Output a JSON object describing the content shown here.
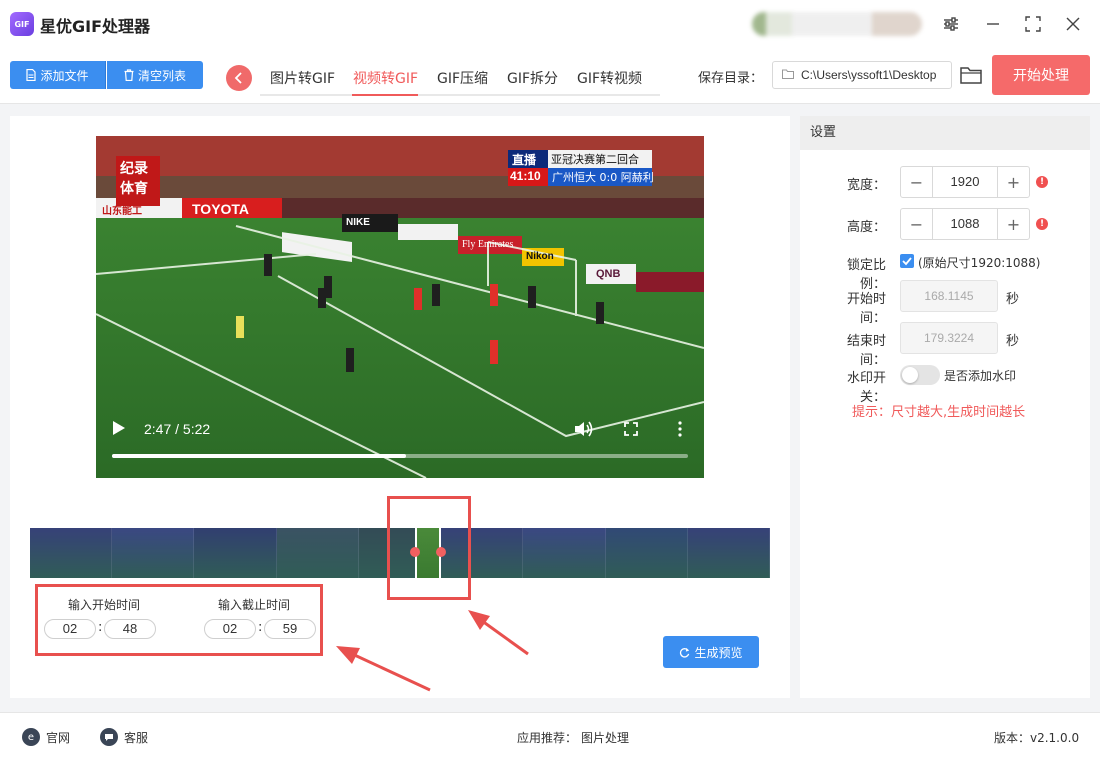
{
  "app": {
    "title": "星优GIF处理器",
    "logo_text": "GIF"
  },
  "toolbar": {
    "add_file": "添加文件",
    "clear_list": "清空列表",
    "tabs": [
      "图片转GIF",
      "视频转GIF",
      "GIF压缩",
      "GIF拆分",
      "GIF转视频"
    ],
    "active_tab": "视频转GIF",
    "save_label": "保存目录：",
    "save_path": "C:\\Users\\yssoft1\\Desktop",
    "start_button": "开始处理"
  },
  "video": {
    "time_display": "2:47 / 5:22",
    "progress": 0.51,
    "overlay": {
      "broadcaster_top": "纪录",
      "broadcaster_bottom": "体育",
      "live_tag": "直播",
      "match_title": "亚冠决赛第二回合",
      "clock": "41:10",
      "score": "广州恒大 0:0 阿赫利",
      "ad_toyota": "TOYOTA",
      "ad_nissin": "山东能工",
      "ad_nike": "NIKE",
      "ad_fly": "Fly Emirates",
      "ad_qnb": "QNB",
      "ad_nikon": "Nikon"
    }
  },
  "filmstrip": {
    "frame_count": 9,
    "selection_start": 0.52,
    "selection_end": 0.555
  },
  "clip": {
    "start_label": "输入开始时间",
    "end_label": "输入截止时间",
    "start_min": "02",
    "start_sec": "48",
    "end_min": "02",
    "end_sec": "59",
    "preview_button": "生成预览"
  },
  "settings": {
    "title": "设置",
    "width_label": "宽度：",
    "width_value": "1920",
    "height_label": "高度：",
    "height_value": "1088",
    "lock_label": "锁定比例：",
    "lock_text": "(原始尺寸1920:1088)",
    "start_label": "开始时间：",
    "start_value": "168.1145",
    "end_label": "结束时间：",
    "end_value": "179.3224",
    "unit": "秒",
    "watermark_label": "水印开关：",
    "watermark_text": "是否添加水印",
    "tip": "提示：尺寸越大,生成时间越长"
  },
  "statusbar": {
    "website": "官网",
    "support": "客服",
    "recommend": "应用推荐：",
    "recommend_app": "图片处理",
    "version": "版本：v2.1.0.0"
  },
  "colors": {
    "accent_blue": "#3b8ef0",
    "accent_red": "#f56a6a",
    "highlight_box": "#e8504e"
  }
}
